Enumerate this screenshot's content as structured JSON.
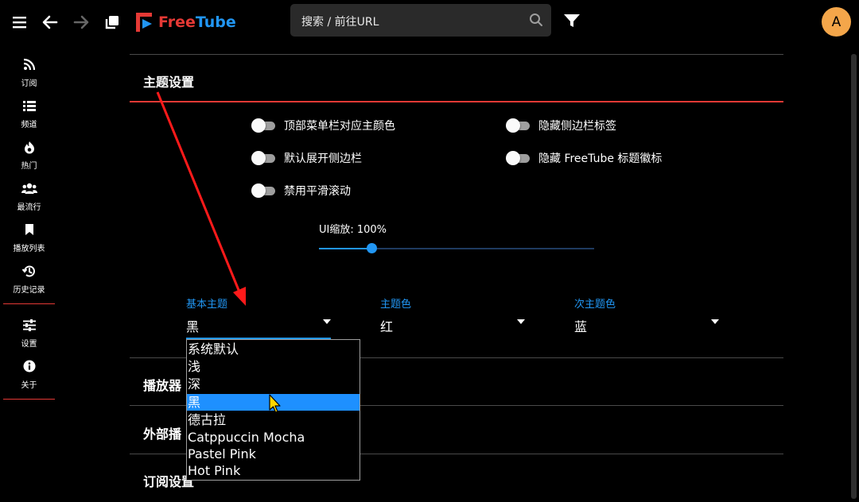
{
  "app": {
    "logo_free": "Free",
    "logo_tube": "Tube"
  },
  "topbar": {
    "search_placeholder": "搜索 / 前往URL",
    "avatar_letter": "A"
  },
  "sidebar": {
    "items": [
      {
        "label": "订阅",
        "icon": "rss-icon"
      },
      {
        "label": "频道",
        "icon": "list-icon"
      },
      {
        "label": "热门",
        "icon": "fire-icon"
      },
      {
        "label": "最流行",
        "icon": "users-icon"
      },
      {
        "label": "播放列表",
        "icon": "bookmark-icon"
      },
      {
        "label": "历史记录",
        "icon": "history-icon"
      },
      {
        "label": "设置",
        "icon": "sliders-icon"
      },
      {
        "label": "关于",
        "icon": "info-icon"
      }
    ]
  },
  "theme": {
    "title": "主题设置",
    "toggles": [
      {
        "label": "顶部菜单栏对应主颜色",
        "on": false
      },
      {
        "label": "隐藏侧边栏标签",
        "on": false
      },
      {
        "label": "默认展开侧边栏",
        "on": false
      },
      {
        "label": "隐藏 FreeTube 标题徽标",
        "on": false
      },
      {
        "label": "禁用平滑滚动",
        "on": false
      }
    ],
    "ui_scale_label": "UI缩放: 100%",
    "ui_scale_fraction": 0.19,
    "selects": [
      {
        "label": "基本主题",
        "value": "黑"
      },
      {
        "label": "主题色",
        "value": "红"
      },
      {
        "label": "次主题色",
        "value": "蓝"
      }
    ]
  },
  "sections": {
    "player_partial": "播放器",
    "external_partial": "外部播",
    "subscription_partial": "订阅设置"
  },
  "dropdown": {
    "options": [
      "系统默认",
      "浅",
      "深",
      "黑",
      "德古拉",
      "Catppuccin Mocha",
      "Pastel Pink",
      "Hot Pink"
    ],
    "highlighted": "黑"
  },
  "colors": {
    "accent_red": "#e53935",
    "accent_blue": "#2196f3",
    "highlight": "#1e90ff",
    "avatar_bg": "#f4a64a"
  }
}
